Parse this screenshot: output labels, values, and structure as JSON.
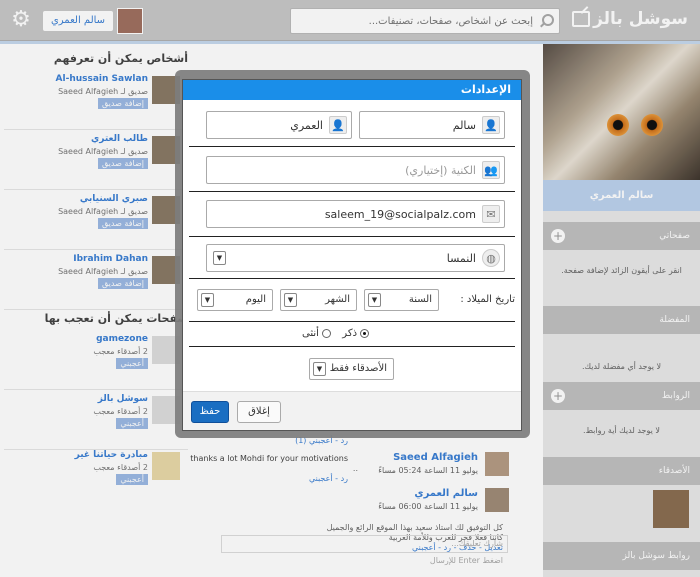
{
  "header": {
    "brand": "سوشل بالز",
    "search_placeholder": "إبحث عن أشخاص، صفحات، تصنيفات...",
    "user_name": "سالم العمري"
  },
  "profile": {
    "name": "سالم العمري"
  },
  "right_sections": [
    {
      "title": "صفحاتي",
      "body": "انقر على أيقون الزائد لإضافة صفحة."
    },
    {
      "title": "المفضلة",
      "body": "لا يوجد أي مفضلة لديك."
    },
    {
      "title": "الروابط",
      "body": "لا يوجد لديك أية روابط."
    },
    {
      "title": "الأصدقاء",
      "body": ""
    },
    {
      "title": "روابط سوشل بالز",
      "body": ""
    }
  ],
  "people": {
    "heading": "أشخاص يمكن أن تعرفهم",
    "items": [
      {
        "name": "Al-hussain Sawlan",
        "friend_of": "صديق لـ Saeed Alfagieh",
        "action": "إضافة صديق"
      },
      {
        "name": "طالب العتري",
        "friend_of": "صديق لـ Saeed Alfagieh",
        "action": "إضافة صديق"
      },
      {
        "name": "صبري السنيابي",
        "friend_of": "صديق لـ Saeed Alfagieh",
        "action": "إضافة صديق"
      },
      {
        "name": "Ibrahim Dahan",
        "friend_of": "صديق لـ Saeed Alfagieh",
        "action": "إضافة صديق"
      }
    ]
  },
  "pages": {
    "heading": "صفحات يمكن أن تعجب بها",
    "items": [
      {
        "name": "gamezone",
        "meta": "2 أصدقاء معجب",
        "action": "أعجبني"
      },
      {
        "name": "سوشل بالز",
        "meta": "2 أصدقاء معجب",
        "action": "أعجبني"
      },
      {
        "name": "مبادرة حياتنا غير",
        "meta": "2 أصدقاء معجب",
        "action": "أعجبني"
      }
    ]
  },
  "feed": {
    "likes_link": "رد - أعجبني (1)",
    "comment_text": "thanks a lot Mohdi for your motivations",
    "dots": "..",
    "reply_link": "رد - أعجبني",
    "author1": "Saeed Alfagieh",
    "time1": "يوليو 11 الساعة 05:24 مساءً",
    "author2": "سالم العمري",
    "time2": "يوليو 11 الساعة 06:00 مساءً",
    "post_text": "كل التوفيق لك استاذ سعيد بهذا الموقع الرائع والجميل",
    "post_text2": "كاننا فعلا فخر للعرب وللأمة العربية",
    "actions": "تعديل - حذف - رد - أعجبني",
    "comment_placeholder": "شارك تعليقك...",
    "enter_hint": "اضغط Enter للإرسال"
  },
  "modal": {
    "title": "الإعدادات",
    "first_name": "سالم",
    "last_name": "العمري",
    "nickname_placeholder": "الكنية (إختياري)",
    "email": "saleem_19@socialpalz.com",
    "country": "النمسا",
    "birthdate_label": "تاريخ الميلاد :",
    "year": "السنة",
    "month": "الشهر",
    "day": "اليوم",
    "gender_male": "ذكر",
    "gender_female": "أنثى",
    "privacy": "الأصدقاء فقط",
    "save": "حفظ",
    "close": "إغلاق"
  }
}
